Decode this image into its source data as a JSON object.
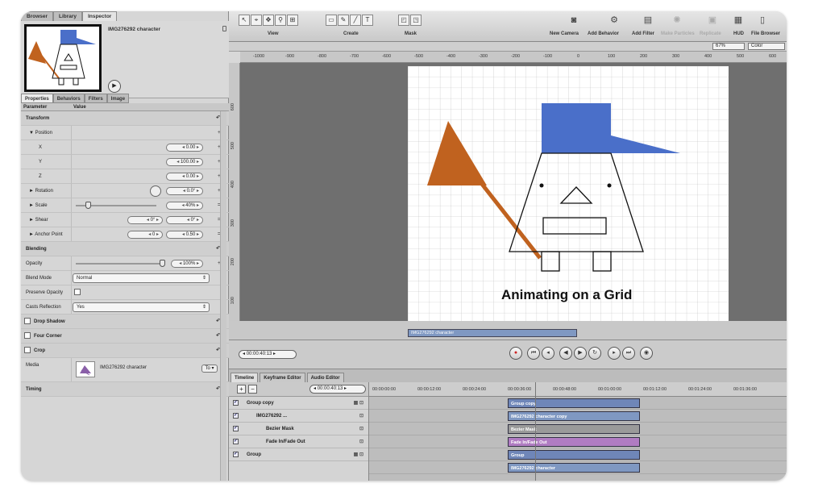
{
  "inspector": {
    "tabs": [
      "Browser",
      "Library",
      "Inspector"
    ],
    "preview_title": "IMG276292 character",
    "subtabs": [
      "Properties",
      "Behaviors",
      "Filters",
      "Image"
    ],
    "col_param": "Parameter",
    "col_value": "Value",
    "rows": {
      "transform": "Transform",
      "position": "▼ Position",
      "x": "X",
      "x_val": "0.00",
      "y": "Y",
      "y_val": "100.00",
      "z": "Z",
      "z_val": "0.00",
      "rotation": "► Rotation",
      "rotation_val": "0.0°",
      "scale": "► Scale",
      "scale_val": "40%",
      "shear": "► Shear",
      "shear_val1": "0°",
      "shear_val2": "0°",
      "anchor": "► Anchor Point",
      "anchor_val1": "0",
      "anchor_val2": "0.50",
      "blending": "Blending",
      "opacity": "Opacity",
      "opacity_val": "100%",
      "blend_mode": "Blend Mode",
      "blend_mode_val": "Normal",
      "preserve_opacity": "Preserve Opacity",
      "casts_reflection": "Casts Reflection",
      "casts_reflection_val": "Yes",
      "drop_shadow": "Drop Shadow",
      "four_corner": "Four Corner",
      "crop": "Crop",
      "media": "Media",
      "media_val": "IMG276292 character",
      "to_label": "To ▾",
      "timing": "Timing"
    }
  },
  "toolbar": {
    "view_label": "View",
    "create_label": "Create",
    "mask_label": "Mask",
    "new_camera": "New Camera",
    "add_behavior": "Add Behavior",
    "add_filter": "Add Filter",
    "make_particles": "Make Particles",
    "replicate": "Replicate",
    "hud": "HUD",
    "file_browser": "File Browser",
    "zoom_val": "67%",
    "color_val": "Color"
  },
  "ruler": {
    "h_ticks": [
      "-1000",
      "-900",
      "-800",
      "-700",
      "-600",
      "-500",
      "-400",
      "-300",
      "-200",
      "-100",
      "0",
      "100",
      "200",
      "300",
      "400",
      "500",
      "600"
    ],
    "v_ticks": [
      "600",
      "500",
      "400",
      "300",
      "200",
      "100"
    ]
  },
  "canvas": {
    "caption": "Animating on a Grid",
    "clip_label": "IMG276292 character",
    "colors": {
      "hat": "#4a6fc9",
      "flag": "#c0621f",
      "grid": "#bdbdbd"
    }
  },
  "transport": {
    "timecode": "00:00:40:13"
  },
  "timeline": {
    "tabs": [
      "Timeline",
      "Keyframe Editor",
      "Audio Editor"
    ],
    "timecode": "00:00:40:13",
    "ruler_ticks": [
      "00:00:00:00",
      "00:00:12:00",
      "00:00:24:00",
      "00:00:36:00",
      "00:00:48:00",
      "00:01:00:00",
      "00:01:12:00",
      "00:01:24:00",
      "00:01:36:00"
    ],
    "layers": [
      {
        "name": "Group copy"
      },
      {
        "name": "IMG276292 ..."
      },
      {
        "name": "Bezier Mask"
      },
      {
        "name": "Fade In/Fade Out"
      },
      {
        "name": "Group"
      }
    ],
    "bars": [
      {
        "label": "Group copy",
        "color": "#6f86b8"
      },
      {
        "label": "IMG276292 character copy",
        "color": "#7f98c2"
      },
      {
        "label": "Bezier Mask",
        "color": "#9a9a9a"
      },
      {
        "label": "Fade In/Fade Out",
        "color": "#b07cc2"
      },
      {
        "label": "Group",
        "color": "#6f86b8"
      },
      {
        "label": "IMG276292 character",
        "color": "#7f98c2"
      }
    ]
  }
}
